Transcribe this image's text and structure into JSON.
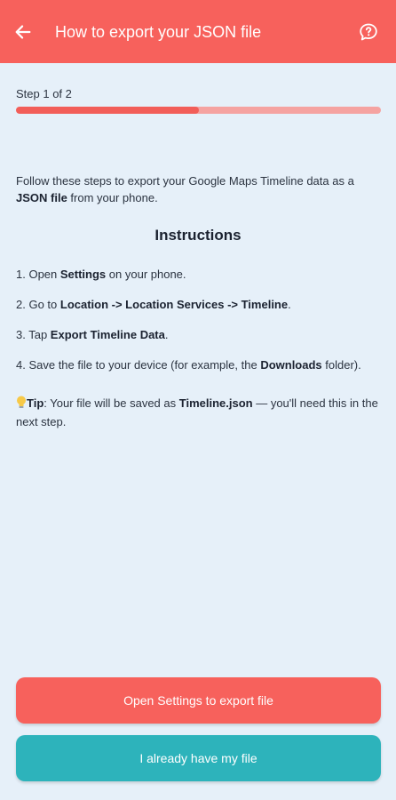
{
  "colors": {
    "appbar": "#f7615c",
    "background": "#e6f0f9",
    "progress_fill": "#f25e59",
    "progress_track": "#f5a3a1",
    "primary_button": "#f7615c",
    "secondary_button": "#2db3bb"
  },
  "appbar": {
    "title": "How to export your JSON file",
    "back_icon": "arrow-left-icon",
    "help_icon": "help-chat-icon"
  },
  "progress": {
    "label": "Step 1 of 2",
    "fraction": 0.5
  },
  "intro": {
    "text_1": "Follow these steps to export your Google Maps Timeline data as a ",
    "bold_1": "JSON file",
    "text_2": " from your phone."
  },
  "instructions": {
    "heading": "Instructions",
    "step1": {
      "prefix": "1. Open ",
      "bold": "Settings",
      "suffix": " on your phone."
    },
    "step2": {
      "prefix": "2. Go to ",
      "bold": "Location -> Location Services -> Timeline",
      "suffix": "."
    },
    "step3": {
      "prefix": "3. Tap ",
      "bold": "Export Timeline Data",
      "suffix": "."
    },
    "step4": {
      "prefix": "4. Save the file to your device (for example, the ",
      "bold": "Downloads",
      "suffix": " folder)."
    }
  },
  "tip": {
    "label": "Tip",
    "text_1": ": Your file will be saved as ",
    "filename": "Timeline.json",
    "text_2": " — you'll need this in the next step."
  },
  "buttons": {
    "primary": "Open Settings to export file",
    "secondary": "I already have my file"
  }
}
